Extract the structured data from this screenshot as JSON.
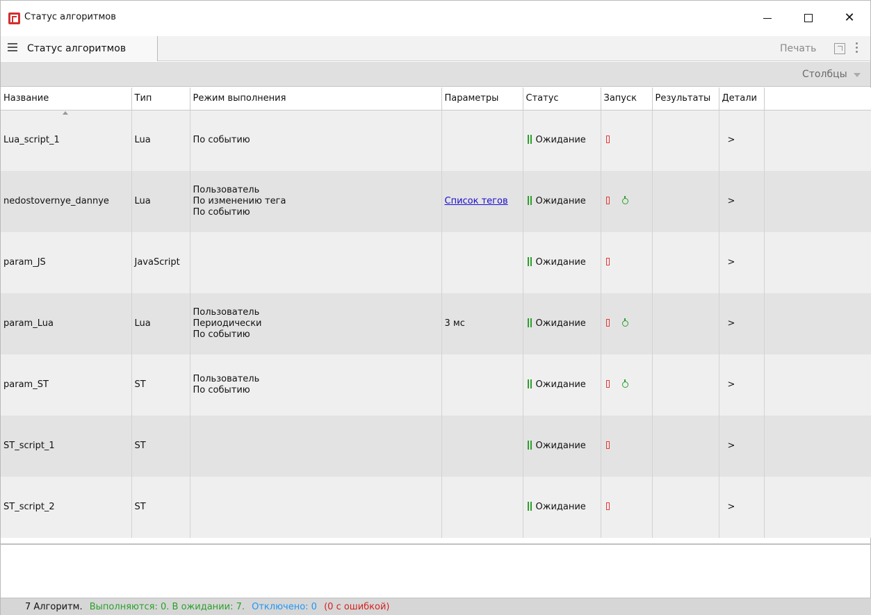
{
  "window": {
    "title": "Статус алгоритмов"
  },
  "toolbar": {
    "tab_label": "Статус алгоритмов",
    "print_label": "Печать",
    "icons": [
      "menu-icon",
      "expand-icon",
      "kebab-icon"
    ]
  },
  "columns_bar": {
    "label": "Столбцы"
  },
  "table": {
    "headers": [
      "Название",
      "Тип",
      "Режим выполнения",
      "Параметры",
      "Статус",
      "Запуск",
      "Результаты",
      "Детали"
    ],
    "rows": [
      {
        "name": "Lua_script_1",
        "type": "Lua",
        "modes": [
          "По событию"
        ],
        "params": "",
        "params_is_link": false,
        "status": "Ожидание",
        "has_start": false,
        "details": ">"
      },
      {
        "name": "nedostovernye_dannye",
        "type": "Lua",
        "modes": [
          "Пользователь",
          "По изменению тега",
          "По событию"
        ],
        "params": "Список тегов",
        "params_is_link": true,
        "status": "Ожидание",
        "has_start": true,
        "details": ">"
      },
      {
        "name": "param_JS",
        "type": "JavaScript",
        "modes": [],
        "params": "",
        "params_is_link": false,
        "status": "Ожидание",
        "has_start": false,
        "details": ">"
      },
      {
        "name": "param_Lua",
        "type": "Lua",
        "modes": [
          "Пользователь",
          "Периодически",
          "По событию"
        ],
        "params": "3 мс",
        "params_is_link": false,
        "status": "Ожидание",
        "has_start": true,
        "details": ">"
      },
      {
        "name": "param_ST",
        "type": "ST",
        "modes": [
          "Пользователь",
          "По событию"
        ],
        "params": "",
        "params_is_link": false,
        "status": "Ожидание",
        "has_start": true,
        "details": ">"
      },
      {
        "name": "ST_script_1",
        "type": "ST",
        "modes": [],
        "params": "",
        "params_is_link": false,
        "status": "Ожидание",
        "has_start": false,
        "details": ">"
      },
      {
        "name": "ST_script_2",
        "type": "ST",
        "modes": [],
        "params": "",
        "params_is_link": false,
        "status": "Ожидание",
        "has_start": false,
        "details": ">"
      }
    ]
  },
  "statusbar": {
    "total": "7 Алгоритм.",
    "running": "Выполняются: 0. В ожидании: 7.",
    "disabled": "Отключено: 0",
    "error": "(0 с ошибкой)"
  },
  "colors": {
    "accent_green": "#2ca02c",
    "accent_red": "#d62020",
    "accent_blue": "#2196f3",
    "link": "#1a0dcc"
  }
}
